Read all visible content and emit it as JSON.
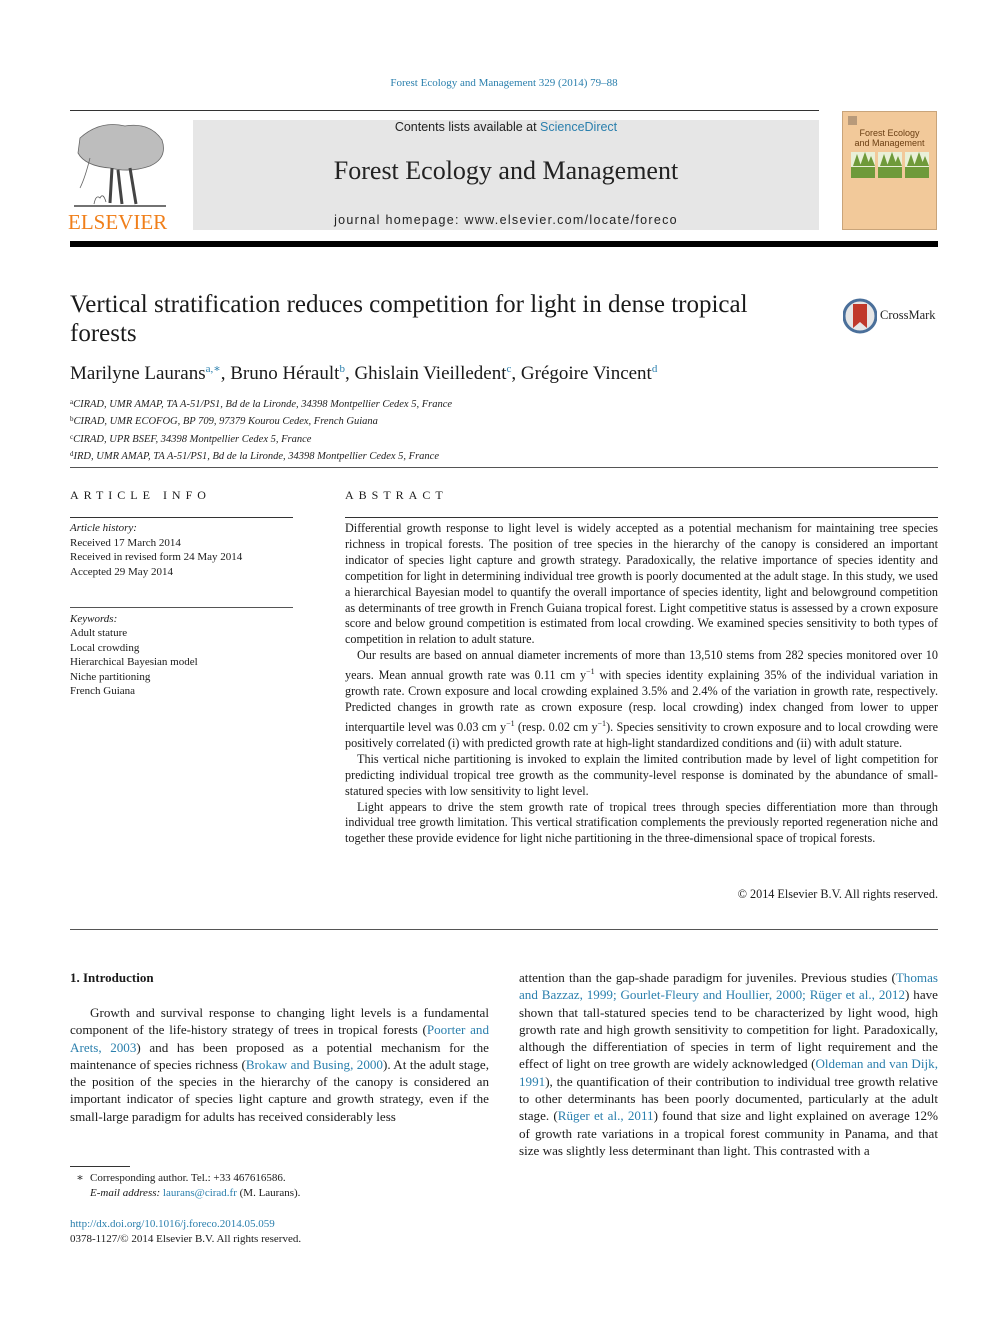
{
  "citation": "Forest Ecology and Management 329 (2014) 79–88",
  "header": {
    "contents_prefix": "Contents lists available at ",
    "contents_link": "ScienceDirect",
    "journal_title": "Forest Ecology and Management",
    "homepage": "journal homepage: www.elsevier.com/locate/foreco",
    "publisher_logo_text": "ELSEVIER",
    "cover_title_line1": "Forest Ecology",
    "cover_title_line2": "and Management",
    "colors": {
      "publisher_orange": "#f07f1a",
      "link_blue": "#2a7fad",
      "cover_bg": "#f2c99a",
      "header_bg": "#e6e6e6"
    }
  },
  "crossmark_label": "CrossMark",
  "article": {
    "title": "Vertical stratification reduces competition for light in dense tropical forests",
    "authors": [
      {
        "name": "Marilyne Laurans",
        "sup": "a,∗",
        "sep": ", "
      },
      {
        "name": "Bruno Hérault",
        "sup": "b",
        "sep": ", "
      },
      {
        "name": "Ghislain Vieilledent",
        "sup": "c",
        "sep": ", "
      },
      {
        "name": "Grégoire Vincent",
        "sup": "d",
        "sep": ""
      }
    ],
    "affiliations": [
      {
        "sup": "a",
        "text": "CIRAD, UMR AMAP, TA A-51/PS1, Bd de la Lironde, 34398 Montpellier Cedex 5, France"
      },
      {
        "sup": "b",
        "text": "CIRAD, UMR ECOFOG, BP 709, 97379 Kourou Cedex, French Guiana"
      },
      {
        "sup": "c",
        "text": "CIRAD, UPR BSEF, 34398 Montpellier Cedex 5, France"
      },
      {
        "sup": "d",
        "text": "IRD, UMR AMAP, TA A-51/PS1, Bd de la Lironde, 34398 Montpellier Cedex 5, France"
      }
    ]
  },
  "article_info": {
    "heading": "ARTICLE INFO",
    "history_label": "Article history:",
    "history": [
      "Received 17 March 2014",
      "Received in revised form 24 May 2014",
      "Accepted 29 May 2014"
    ],
    "keywords_label": "Keywords:",
    "keywords": [
      "Adult stature",
      "Local crowding",
      "Hierarchical Bayesian model",
      "Niche partitioning",
      "French Guiana"
    ]
  },
  "abstract": {
    "heading": "ABSTRACT",
    "p1": "Differential growth response to light level is widely accepted as a potential mechanism for maintaining tree species richness in tropical forests. The position of tree species in the hierarchy of the canopy is considered an important indicator of species light capture and growth strategy. Paradoxically, the relative importance of species identity and competition for light in determining individual tree growth is poorly documented at the adult stage. In this study, we used a hierarchical Bayesian model to quantify the overall importance of species identity, light and belowground competition as determinants of tree growth in French Guiana tropical forest. Light competitive status is assessed by a crown exposure score and below ground competition is estimated from local crowding. We examined species sensitivity to both types of competition in relation to adult stature.",
    "p2_a": "Our results are based on annual diameter increments of more than 13,510 stems from 282 species monitored over 10 years. Mean annual growth rate was 0.11 cm y",
    "p2_b": " with species identity explaining 35% of the individual variation in growth rate. Crown exposure and local crowding explained 3.5% and 2.4% of the variation in growth rate, respectively. Predicted changes in growth rate as crown exposure (resp. local crowding) index changed from lower to upper interquartile level was 0.03 cm y",
    "p2_c": " (resp. 0.02 cm y",
    "p2_d": "). Species sensitivity to crown exposure and to local crowding were positively correlated (i) with predicted growth rate at high-light standardized conditions and (ii) with adult stature.",
    "exp": "−1",
    "p3": "This vertical niche partitioning is invoked to explain the limited contribution made by level of light competition for predicting individual tropical tree growth as the community-level response is dominated by the abundance of small-statured species with low sensitivity to light level.",
    "p4": "Light appears to drive the stem growth rate of tropical trees through species differentiation more than through individual tree growth limitation. This vertical stratification complements the previously reported regeneration niche and together these provide evidence for light niche partitioning in the three-dimensional space of tropical forests.",
    "copyright": "© 2014 Elsevier B.V. All rights reserved."
  },
  "introduction": {
    "heading": "1. Introduction",
    "left": {
      "t1": "Growth and survival response to changing light levels is a fundamental component of the life-history strategy of trees in tropical forests (",
      "c1": "Poorter and Arets, 2003",
      "t2": ") and has been proposed as a potential mechanism for the maintenance of species richness (",
      "c2": "Brokaw and Busing, 2000",
      "t3": "). At the adult stage, the position of the species in the hierarchy of the canopy is considered an important indicator of species light capture and growth strategy, even if the small-large paradigm for adults has received considerably less"
    },
    "right": {
      "t1": "attention than the gap-shade paradigm for juveniles. Previous studies (",
      "c1": "Thomas and Bazzaz, 1999; Gourlet-Fleury and Houllier, 2000; Rüger et al., 2012",
      "t2": ") have shown that tall-statured species tend to be characterized by light wood, high growth rate and high growth sensitivity to competition for light. Paradoxically, although the differentiation of species in term of light requirement and the effect of light on tree growth are widely acknowledged (",
      "c2": "Oldeman and van Dijk, 1991",
      "t3": "), the quantification of their contribution to individual tree growth relative to other determinants has been poorly documented, particularly at the adult stage. (",
      "c3": "Rüger et al., 2011",
      "t4": ") found that size and light explained on average 12% of growth rate variations in a tropical forest community in Panama, and that size was slightly less determinant than light. This contrasted with a"
    }
  },
  "footnote": {
    "mark": "∗",
    "corresponding": "Corresponding author. Tel.: +33 467616586.",
    "email_label": "E-mail address:",
    "email": "laurans@cirad.fr",
    "email_suffix": " (M. Laurans)."
  },
  "doi": {
    "url": "http://dx.doi.org/10.1016/j.foreco.2014.05.059",
    "issn_line": "0378-1127/© 2014 Elsevier B.V. All rights reserved."
  }
}
